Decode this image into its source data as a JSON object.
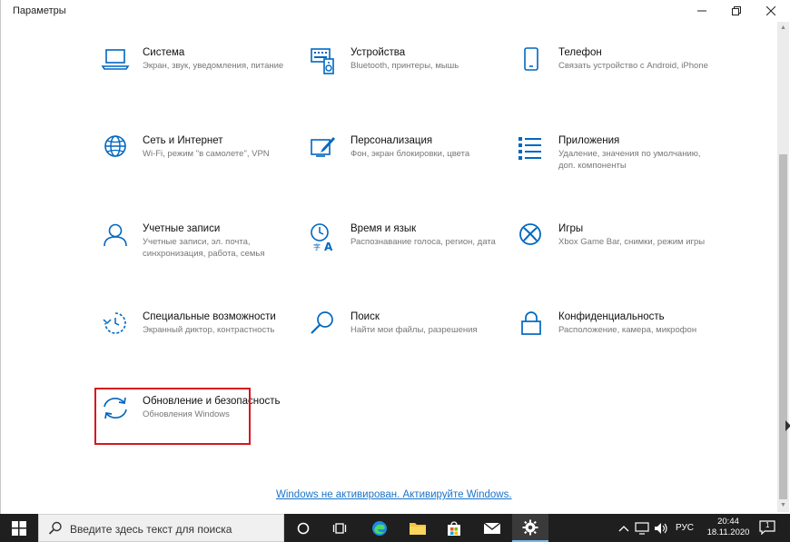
{
  "window": {
    "title": "Параметры"
  },
  "tiles": [
    {
      "id": "system",
      "title": "Система",
      "subtitle": "Экран, звук, уведомления, питание",
      "icon": "laptop-icon"
    },
    {
      "id": "devices",
      "title": "Устройства",
      "subtitle": "Bluetooth, принтеры, мышь",
      "icon": "keyboard-speaker-icon"
    },
    {
      "id": "phone",
      "title": "Телефон",
      "subtitle": "Связать устройство с Android, iPhone",
      "icon": "phone-icon"
    },
    {
      "id": "network",
      "title": "Сеть и Интернет",
      "subtitle": "Wi-Fi, режим \"в самолете\", VPN",
      "icon": "globe-icon"
    },
    {
      "id": "personalization",
      "title": "Персонализация",
      "subtitle": "Фон, экран блокировки, цвета",
      "icon": "brush-icon"
    },
    {
      "id": "apps",
      "title": "Приложения",
      "subtitle": "Удаление, значения по умолчанию, доп. компоненты",
      "icon": "app-list-icon"
    },
    {
      "id": "accounts",
      "title": "Учетные записи",
      "subtitle": "Учетные записи, эл. почта, синхронизация, работа, семья",
      "icon": "person-icon"
    },
    {
      "id": "time",
      "title": "Время и язык",
      "subtitle": "Распознавание голоса, регион, дата",
      "icon": "time-language-icon"
    },
    {
      "id": "gaming",
      "title": "Игры",
      "subtitle": "Xbox Game Bar, снимки, режим игры",
      "icon": "xbox-icon"
    },
    {
      "id": "ease",
      "title": "Специальные возможности",
      "subtitle": "Экранный диктор, контрастность",
      "icon": "ease-of-access-icon"
    },
    {
      "id": "search",
      "title": "Поиск",
      "subtitle": "Найти мои файлы, разрешения",
      "icon": "search-icon"
    },
    {
      "id": "privacy",
      "title": "Конфиденциальность",
      "subtitle": "Расположение, камера, микрофон",
      "icon": "lock-icon"
    },
    {
      "id": "update",
      "title": "Обновление и безопасность",
      "subtitle": "Обновления Windows",
      "icon": "sync-icon"
    }
  ],
  "activation_link": "Windows не активирован. Активируйте Windows.",
  "taskbar": {
    "search_placeholder": "Введите здесь текст для поиска",
    "language": "РУС",
    "time": "20:44",
    "date": "18.11.2020",
    "notifications_count": "1"
  },
  "colors": {
    "accent": "#0067c0",
    "highlight_border": "#d7161d",
    "taskbar": "#1f1f1f"
  }
}
